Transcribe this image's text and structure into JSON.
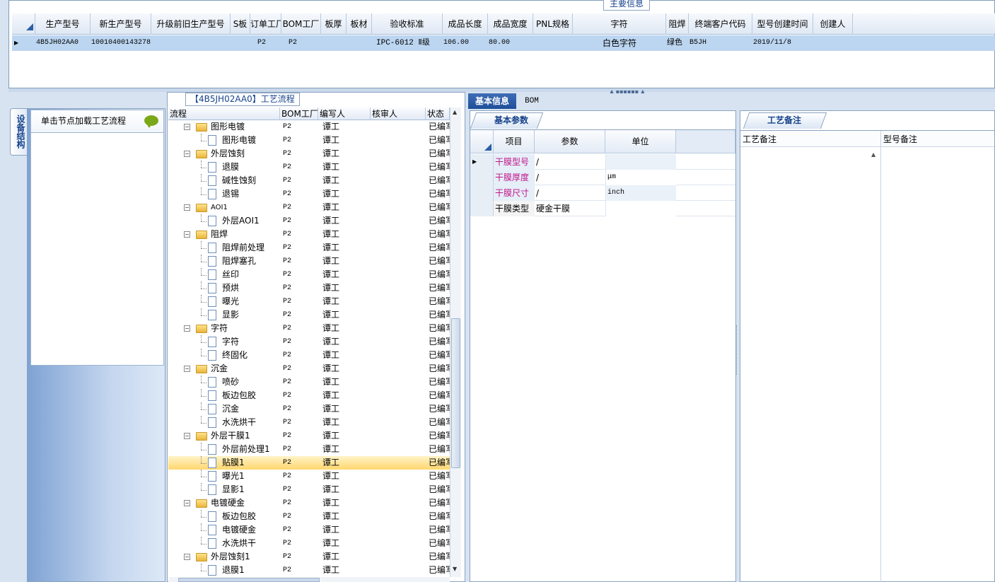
{
  "main_info": {
    "legend": "主要信息",
    "columns": [
      "生产型号",
      "新生产型号",
      "升级前旧生产型号",
      "S板",
      "订单工厂",
      "BOM工厂",
      "板厚",
      "板材",
      "验收标准",
      "成品长度",
      "成品宽度",
      "PNL规格",
      "字符",
      "阻焊",
      "终端客户代码",
      "型号创建时间",
      "创建人"
    ],
    "row": {
      "生产型号": "4B5JH02AA0",
      "新生产型号": "10010400143278",
      "订单工厂": "P2",
      "BOM工厂": "P2",
      "验收标准": "IPC-6012 Ⅱ级",
      "成品长度": "106.00",
      "成品宽度": "80.00",
      "字符": "白色字符",
      "阻焊": "绿色",
      "终端客户代码": "B5JH",
      "型号创建时间": "2019/11/8"
    }
  },
  "left_panel": {
    "vertical_tab": "设备结构",
    "load_hint": "单击节点加载工艺流程",
    "bubble_icon": "comment-bubble-icon"
  },
  "flow": {
    "title": "【4B5JH02AA0】工艺流程",
    "columns": [
      "流程",
      "BOM工厂",
      "编写人",
      "核审人",
      "状态"
    ],
    "rows": [
      {
        "name": "图形电镀",
        "level": 1,
        "type": "folder",
        "bom": "P2",
        "writer": "谭工",
        "status": "已编写"
      },
      {
        "name": "图形电镀",
        "level": 2,
        "type": "doc",
        "bom": "P2",
        "writer": "谭工",
        "status": "已编写"
      },
      {
        "name": "外层蚀刻",
        "level": 1,
        "type": "folder",
        "bom": "P2",
        "writer": "谭工",
        "status": "已编写"
      },
      {
        "name": "退膜",
        "level": 2,
        "type": "doc",
        "bom": "P2",
        "writer": "谭工",
        "status": "已编写"
      },
      {
        "name": "碱性蚀刻",
        "level": 2,
        "type": "doc",
        "bom": "P2",
        "writer": "谭工",
        "status": "已编写"
      },
      {
        "name": "退锡",
        "level": 2,
        "type": "doc",
        "bom": "P2",
        "writer": "谭工",
        "status": "已编写"
      },
      {
        "name": "AOI1",
        "level": 1,
        "type": "folder",
        "bom": "P2",
        "writer": "谭工",
        "status": "已编写"
      },
      {
        "name": "外层AOI1",
        "level": 2,
        "type": "doc",
        "bom": "P2",
        "writer": "谭工",
        "status": "已编写"
      },
      {
        "name": "阻焊",
        "level": 1,
        "type": "folder",
        "bom": "P2",
        "writer": "谭工",
        "status": "已编写"
      },
      {
        "name": "阻焊前处理",
        "level": 2,
        "type": "doc",
        "bom": "P2",
        "writer": "谭工",
        "status": "已编写"
      },
      {
        "name": "阻焊塞孔",
        "level": 2,
        "type": "doc",
        "bom": "P2",
        "writer": "谭工",
        "status": "已编写"
      },
      {
        "name": "丝印",
        "level": 2,
        "type": "doc",
        "bom": "P2",
        "writer": "谭工",
        "status": "已编写"
      },
      {
        "name": "预烘",
        "level": 2,
        "type": "doc",
        "bom": "P2",
        "writer": "谭工",
        "status": "已编写"
      },
      {
        "name": "曝光",
        "level": 2,
        "type": "doc",
        "bom": "P2",
        "writer": "谭工",
        "status": "已编写"
      },
      {
        "name": "显影",
        "level": 2,
        "type": "doc",
        "bom": "P2",
        "writer": "谭工",
        "status": "已编写"
      },
      {
        "name": "字符",
        "level": 1,
        "type": "folder",
        "bom": "P2",
        "writer": "谭工",
        "status": "已编写"
      },
      {
        "name": "字符",
        "level": 2,
        "type": "doc",
        "bom": "P2",
        "writer": "谭工",
        "status": "已编写"
      },
      {
        "name": "终固化",
        "level": 2,
        "type": "doc",
        "bom": "P2",
        "writer": "谭工",
        "status": "已编写"
      },
      {
        "name": "沉金",
        "level": 1,
        "type": "folder",
        "bom": "P2",
        "writer": "谭工",
        "status": "已编写"
      },
      {
        "name": "喷砂",
        "level": 2,
        "type": "doc",
        "bom": "P2",
        "writer": "谭工",
        "status": "已编写"
      },
      {
        "name": "板边包胶",
        "level": 2,
        "type": "doc",
        "bom": "P2",
        "writer": "谭工",
        "status": "已编写"
      },
      {
        "name": "沉金",
        "level": 2,
        "type": "doc",
        "bom": "P2",
        "writer": "谭工",
        "status": "已编写"
      },
      {
        "name": "水洗烘干",
        "level": 2,
        "type": "doc",
        "bom": "P2",
        "writer": "谭工",
        "status": "已编写"
      },
      {
        "name": "外层干膜1",
        "level": 1,
        "type": "folder",
        "bom": "P2",
        "writer": "谭工",
        "status": "已编写"
      },
      {
        "name": "外层前处理1",
        "level": 2,
        "type": "doc",
        "bom": "P2",
        "writer": "谭工",
        "status": "已编写"
      },
      {
        "name": "贴膜1",
        "level": 2,
        "type": "doc",
        "bom": "P2",
        "writer": "谭工",
        "status": "已编写",
        "selected": true
      },
      {
        "name": "曝光1",
        "level": 2,
        "type": "doc",
        "bom": "P2",
        "writer": "谭工",
        "status": "已编写"
      },
      {
        "name": "显影1",
        "level": 2,
        "type": "doc",
        "bom": "P2",
        "writer": "谭工",
        "status": "已编写"
      },
      {
        "name": "电镀硬金",
        "level": 1,
        "type": "folder",
        "bom": "P2",
        "writer": "谭工",
        "status": "已编写"
      },
      {
        "name": "板边包胶",
        "level": 2,
        "type": "doc",
        "bom": "P2",
        "writer": "谭工",
        "status": "已编写"
      },
      {
        "name": "电镀硬金",
        "level": 2,
        "type": "doc",
        "bom": "P2",
        "writer": "谭工",
        "status": "已编写"
      },
      {
        "name": "水洗烘干",
        "level": 2,
        "type": "doc",
        "bom": "P2",
        "writer": "谭工",
        "status": "已编写"
      },
      {
        "name": "外层蚀刻1",
        "level": 1,
        "type": "folder",
        "bom": "P2",
        "writer": "谭工",
        "status": "已编写"
      },
      {
        "name": "退膜1",
        "level": 2,
        "type": "doc",
        "bom": "P2",
        "writer": "谭工",
        "status": "已编写"
      }
    ]
  },
  "right_tabs": {
    "basic": "基本信息",
    "bom": "BOM"
  },
  "basic_params": {
    "tab": "基本参数",
    "columns": [
      "项目",
      "参数",
      "单位"
    ],
    "rows": [
      {
        "item": "干膜型号",
        "param": "/",
        "unit": "",
        "highlight": true
      },
      {
        "item": "干膜厚度",
        "param": "/",
        "unit": "μm",
        "highlight": true
      },
      {
        "item": "干膜尺寸",
        "param": "/",
        "unit": "inch",
        "highlight": true
      },
      {
        "item": "干膜类型",
        "param": "硬金干膜",
        "unit": "",
        "highlight": false
      }
    ]
  },
  "notes": {
    "tab": "工艺备注",
    "col1": "工艺备注",
    "col2": "型号备注"
  },
  "colors": {
    "accent": "#1f4f9a",
    "highlight_text": "#c0168a",
    "selected_row": "#bcd6f1"
  }
}
